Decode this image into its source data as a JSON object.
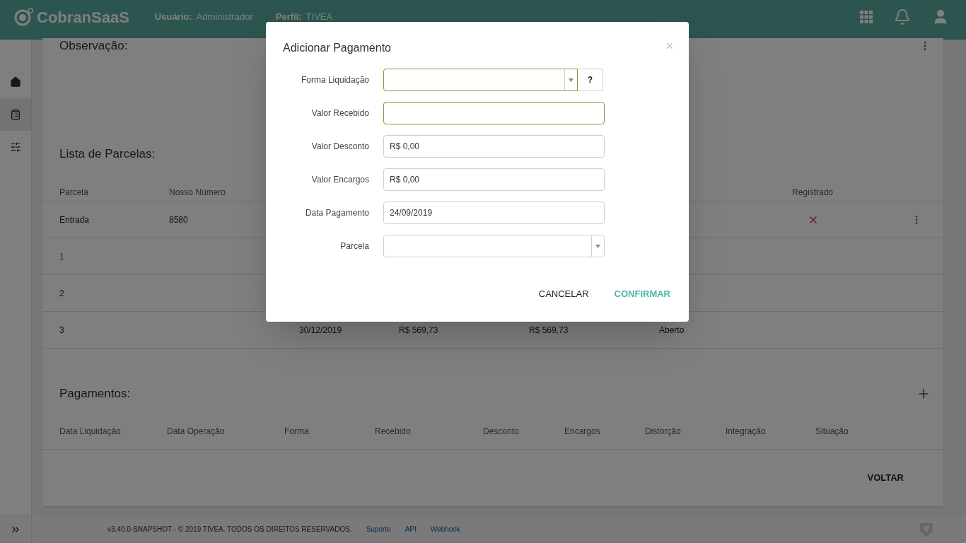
{
  "header": {
    "brand": "CobranSaaS",
    "user_label": "Usuário:",
    "user_value": "Administrador",
    "profile_label": "Perfil:",
    "profile_value": "TIVEA"
  },
  "sidebar": {
    "items": [
      {
        "kind": "home",
        "selected": false
      },
      {
        "kind": "clipboard",
        "selected": true
      },
      {
        "kind": "sliders",
        "selected": false
      }
    ]
  },
  "observacao": {
    "title": "Observação:"
  },
  "parcelas": {
    "title": "Lista de Parcelas:",
    "columns": [
      "Parcela",
      "Nosso Número",
      null,
      null,
      null,
      null,
      "Registrado"
    ],
    "rows": [
      {
        "cells": [
          "Entrada",
          "8580",
          null,
          null,
          null,
          null,
          null
        ],
        "link": false,
        "registered": false,
        "menu": true
      },
      {
        "cells": [
          "1",
          null,
          null,
          null,
          null,
          null,
          null
        ],
        "link": true,
        "menu": false
      },
      {
        "cells": [
          "2",
          null,
          null,
          null,
          null,
          null,
          null
        ],
        "link": false,
        "menu": false
      },
      {
        "cells": [
          "3",
          null,
          "30/12/2019",
          "R$ 569,73",
          "R$ 569,73",
          "Aberto",
          null
        ],
        "link": false,
        "menu": false
      }
    ]
  },
  "pagamentos": {
    "title": "Pagamentos:",
    "columns": [
      "Data Liquidação",
      "Data Operação",
      "Forma",
      "Recebido",
      "Desconto",
      "Encargos",
      "Distorção",
      "Integração",
      "Situação"
    ]
  },
  "back_button": "VOLTAR",
  "footer": {
    "text": "v3.40.0-SNAPSHOT - © 2019 TIVEA. TODOS OS DIREITOS RESERVADOS.",
    "links": [
      "Suporte",
      "API",
      "Webhook"
    ]
  },
  "dialog": {
    "title": "Adicionar Pagamento",
    "close": "×",
    "fields": [
      {
        "label": "Forma Liquidação",
        "kind": "select",
        "highlighted": true,
        "help": "?"
      },
      {
        "label": "Valor Recebido",
        "kind": "text",
        "highlighted": true
      },
      {
        "label": "Valor Desconto",
        "kind": "text",
        "value": "R$ 0,00",
        "highlighted": false
      },
      {
        "label": "Valor Encargos",
        "kind": "text",
        "value": "R$ 0,00",
        "highlighted": false
      },
      {
        "label": "Data Pagamento",
        "kind": "text",
        "value": "24/09/2019",
        "highlighted": false
      },
      {
        "label": "Parcela",
        "kind": "select",
        "highlighted": false
      }
    ],
    "buttons": [
      {
        "label": "CANCELAR",
        "kind": "secondary"
      },
      {
        "label": "CONFIRMAR",
        "kind": "primary"
      }
    ]
  }
}
